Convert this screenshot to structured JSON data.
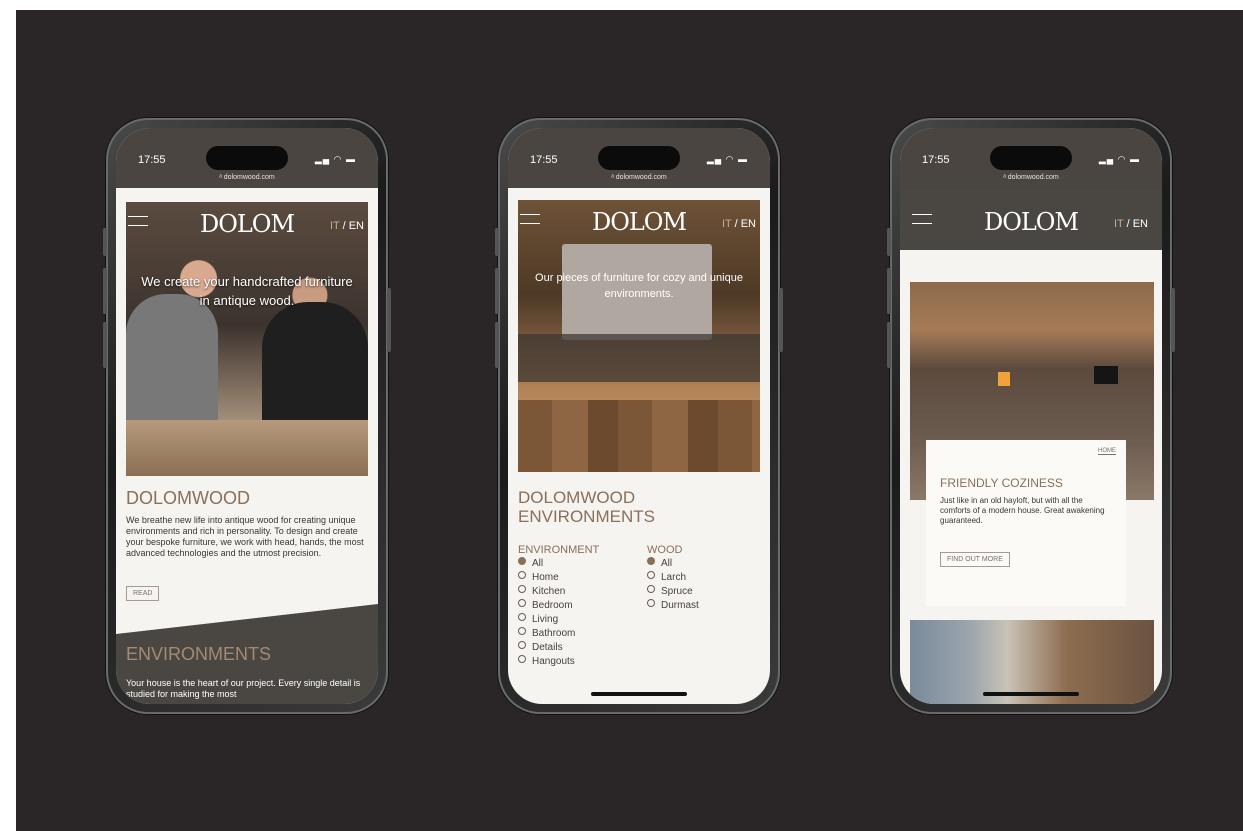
{
  "phones": [
    {
      "statusbar": {
        "time": "17:55",
        "url": "ᵃ dolomwood.com",
        "icons": "signal wifi battery"
      },
      "header": {
        "logo": "DOLOM",
        "lang_it": "IT",
        "lang_sep": " / ",
        "lang_en": "EN"
      },
      "hero_text": "We create your handcrafted furniture in antique wood.",
      "brand_title": "DOLOMWOOD",
      "intro": "We breathe new life into antique wood for creating unique environments and rich in personality. To design and create your bespoke furniture, we work with head, hands, the most advanced technologies and the utmost precision.",
      "read_label": "READ",
      "env_title": "ENVIRONMENTS",
      "env_text": "Your house is the heart of our project. Every single detail is studied for making the most"
    },
    {
      "statusbar": {
        "time": "17:55",
        "url": "ᵃ dolomwood.com"
      },
      "header": {
        "logo": "DOLOM",
        "lang_it": "IT",
        "lang_sep": " / ",
        "lang_en": "EN"
      },
      "hero_text": "Our pieces of furniture for cozy and unique environments.",
      "page_title": "DOLOMWOOD ENVIRONMENTS",
      "environment_filter": {
        "heading": "ENVIRONMENT",
        "options": [
          {
            "label": "All",
            "selected": true
          },
          {
            "label": "Home",
            "selected": false
          },
          {
            "label": "Kitchen",
            "selected": false
          },
          {
            "label": "Bedroom",
            "selected": false
          },
          {
            "label": "Living",
            "selected": false
          },
          {
            "label": "Bathroom",
            "selected": false
          },
          {
            "label": "Details",
            "selected": false
          },
          {
            "label": "Hangouts",
            "selected": false
          }
        ]
      },
      "wood_filter": {
        "heading": "WOOD",
        "options": [
          {
            "label": "All",
            "selected": true
          },
          {
            "label": "Larch",
            "selected": false
          },
          {
            "label": "Spruce",
            "selected": false
          },
          {
            "label": "Durmast",
            "selected": false
          }
        ]
      }
    },
    {
      "statusbar": {
        "time": "17:55",
        "url": "ᵃ dolomwood.com"
      },
      "header": {
        "logo": "DOLOM",
        "lang_it": "IT",
        "lang_sep": " / ",
        "lang_en": "EN"
      },
      "card": {
        "crumb": "HOME",
        "title": "FRIENDLY COZINESS",
        "text": "Just like in an old hayloft, but with all the comforts of a modern house. Great awakening guaranteed.",
        "button": "FIND OUT MORE"
      }
    }
  ],
  "colors": {
    "backdrop": "#2a2627",
    "accent": "#8a6f59",
    "dark_band": "#4a4742",
    "paper": "#f6f4f0"
  }
}
